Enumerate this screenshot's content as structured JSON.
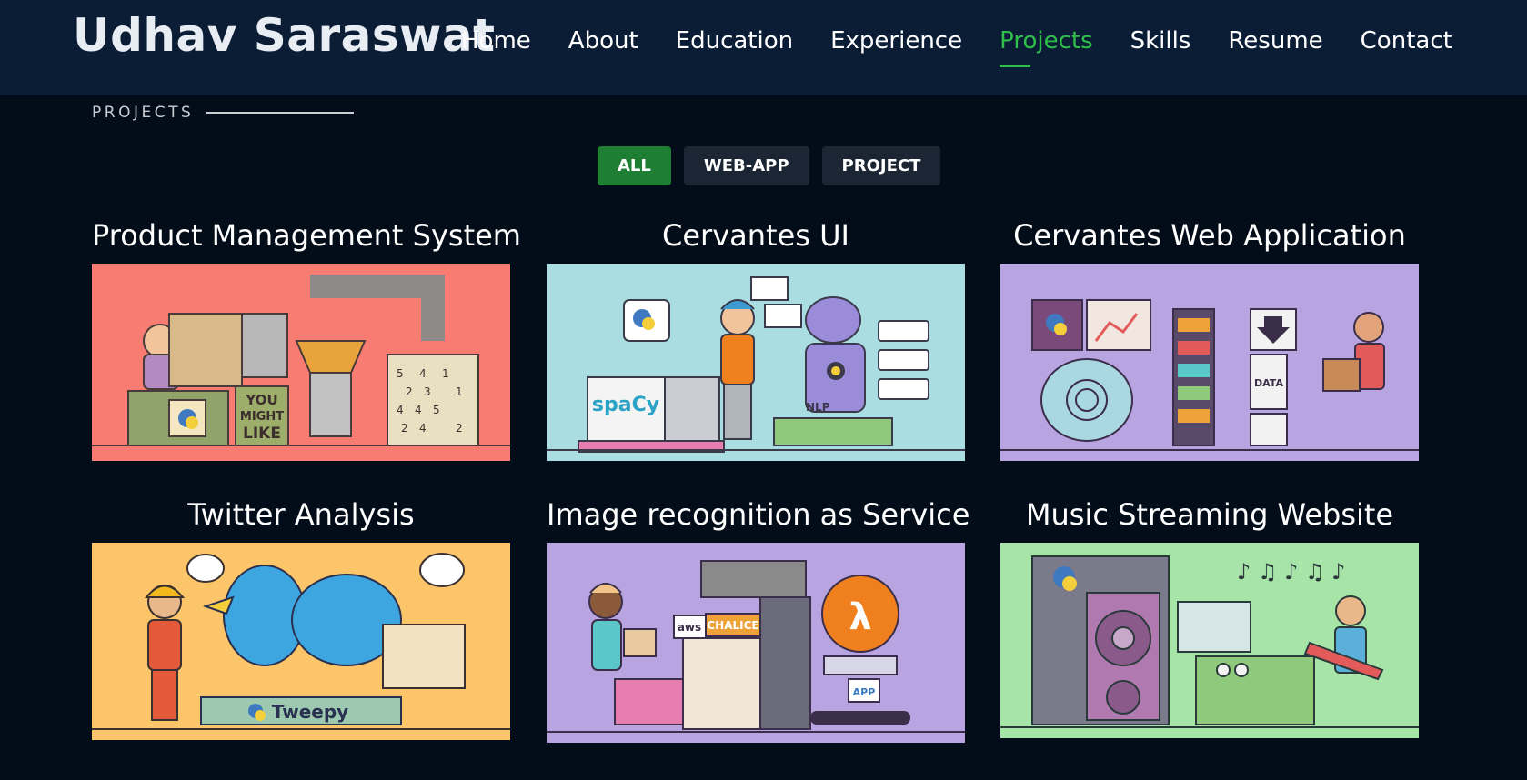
{
  "header": {
    "brand": "Udhav Saraswat",
    "nav": [
      "Home",
      "About",
      "Education",
      "Experience",
      "Projects",
      "Skills",
      "Resume",
      "Contact"
    ],
    "active_nav": "Projects"
  },
  "section": {
    "title": "PROJECTS"
  },
  "filters": {
    "all": "ALL",
    "webapp": "WEB-APP",
    "project": "PROJECT",
    "active": "ALL"
  },
  "colors": {
    "accent": "#2fbf4a",
    "header_bg": "#0b1c35",
    "page_bg": "#030d1a",
    "filter_active": "#1e7e34"
  },
  "projects": [
    {
      "title": "Product Management System",
      "bg": "#f97c72",
      "illustration": "python-factory-illustration",
      "badge": "YOU MIGHT LIKE"
    },
    {
      "title": "Cervantes UI",
      "bg": "#a9dde2",
      "illustration": "spacy-nlp-robot-illustration",
      "badge": "spaCy",
      "badge2": "NLP"
    },
    {
      "title": "Cervantes Web Application",
      "bg": "#b9a4e2",
      "illustration": "data-server-illustration",
      "badge": "DATA"
    },
    {
      "title": "Twitter Analysis",
      "bg": "#fcc56a",
      "illustration": "tweepy-bird-illustration",
      "badge": "Tweepy"
    },
    {
      "title": "Image recognition as Service",
      "bg": "#b9a4e2",
      "illustration": "aws-lambda-illustration",
      "badge": "CHALICE",
      "badge2": "aws",
      "badge3": "APP"
    },
    {
      "title": "Music Streaming Website",
      "bg": "#a7e4a8",
      "illustration": "music-speaker-illustration"
    }
  ]
}
